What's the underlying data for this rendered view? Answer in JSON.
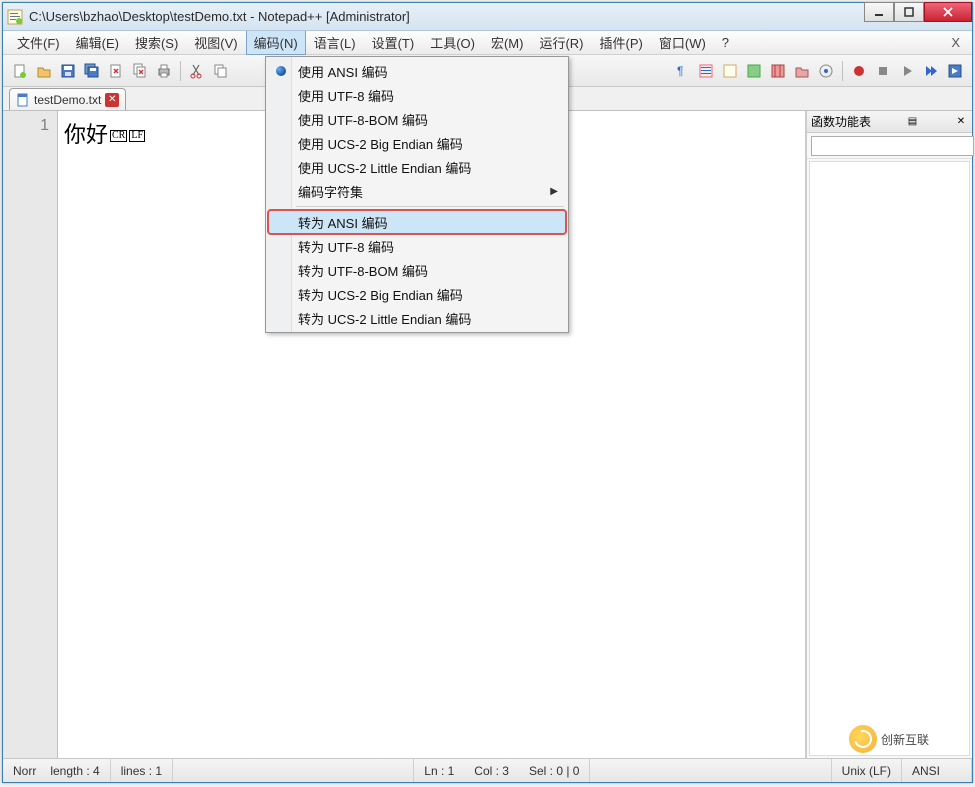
{
  "titlebar": {
    "title": "C:\\Users\\bzhao\\Desktop\\testDemo.txt - Notepad++ [Administrator]"
  },
  "menus": {
    "file": "文件(F)",
    "edit": "编辑(E)",
    "search": "搜索(S)",
    "view": "视图(V)",
    "encoding": "编码(N)",
    "language": "语言(L)",
    "settings": "设置(T)",
    "tools": "工具(O)",
    "macro": "宏(M)",
    "run": "运行(R)",
    "plugins": "插件(P)",
    "window": "窗口(W)",
    "help": "?"
  },
  "encoding_menu": {
    "use_ansi": "使用 ANSI 编码",
    "use_utf8": "使用 UTF-8 编码",
    "use_utf8_bom": "使用 UTF-8-BOM 编码",
    "use_ucs2_be": "使用 UCS-2 Big Endian 编码",
    "use_ucs2_le": "使用 UCS-2 Little Endian 编码",
    "charset": "编码字符集",
    "to_ansi": "转为 ANSI 编码",
    "to_utf8": "转为 UTF-8 编码",
    "to_utf8_bom": "转为 UTF-8-BOM 编码",
    "to_ucs2_be": "转为 UCS-2 Big Endian 编码",
    "to_ucs2_le": "转为 UCS-2 Little Endian 编码"
  },
  "tab": {
    "filename": "testDemo.txt"
  },
  "editor": {
    "line_number": "1",
    "content": "你好",
    "eol1": "CR",
    "eol2": "LF"
  },
  "side_panel": {
    "title": "函数功能表",
    "search_placeholder": ""
  },
  "statusbar": {
    "mode": "Norr",
    "length": "length : 4",
    "lines": "lines : 1",
    "ln": "Ln : 1",
    "col": "Col : 3",
    "sel": "Sel : 0 | 0",
    "eol": "Unix (LF)",
    "encoding": "ANSI"
  },
  "watermark": {
    "text": "创新互联"
  },
  "menubar_close": "X"
}
